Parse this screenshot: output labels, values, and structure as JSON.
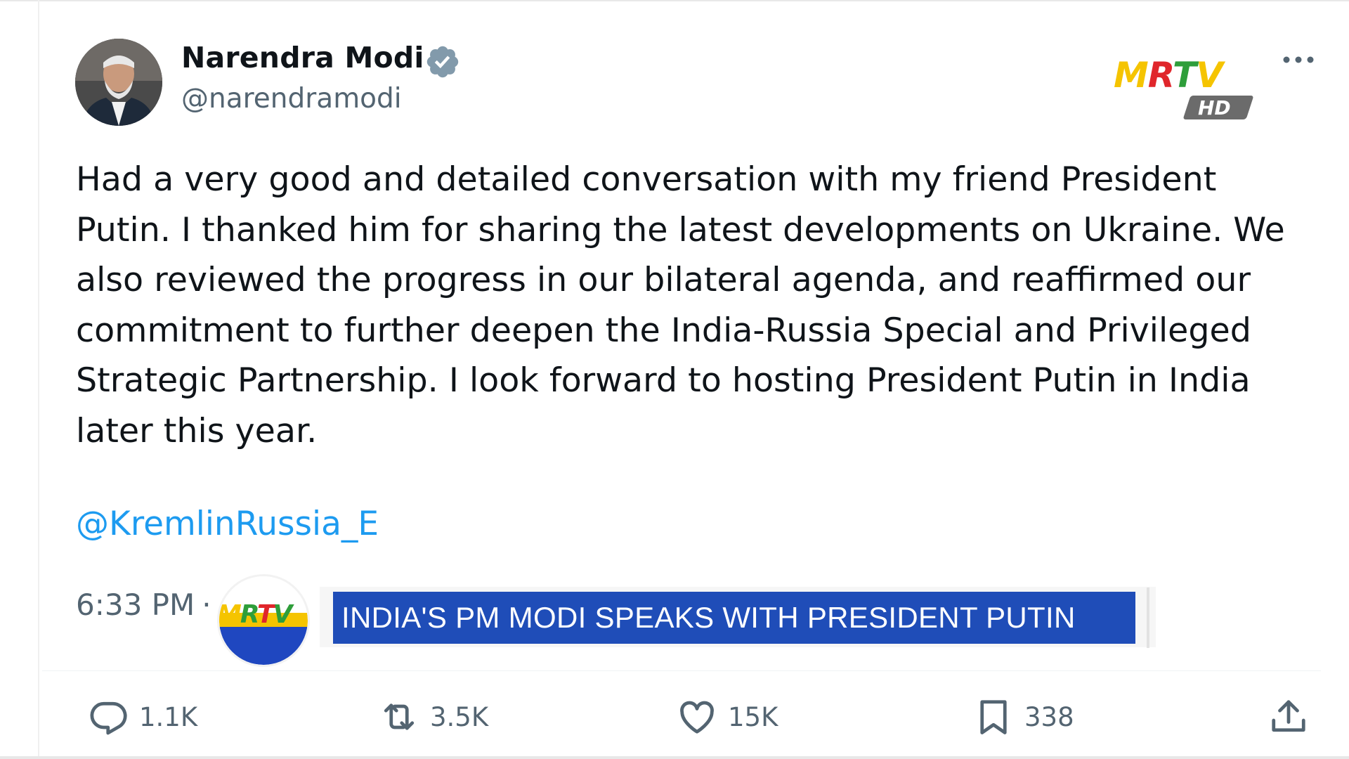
{
  "author": {
    "name": "Narendra Modi",
    "handle": "@narendramodi",
    "verified": true
  },
  "tweet": {
    "text": "Had a very good and detailed conversation with my friend President Putin. I thanked him for sharing the latest developments on Ukraine. We also reviewed the progress in our bilateral agenda, and reaffirmed our commitment to further deepen the India-Russia Special and Privileged Strategic Partnership. I look forward to hosting President Putin in India later this year.",
    "mention": "@KremlinRussia_E",
    "time": "6:33 PM",
    "time_separator": "·"
  },
  "actions": {
    "reply_count": "1.1K",
    "retweet_count": "3.5K",
    "like_count": "15K",
    "bookmark_count": "338"
  },
  "broadcast": {
    "channel_logo": "MRTV",
    "channel_logo_sub": "HD",
    "ticker_logo": "MRTV",
    "ticker_text": "INDIA'S PM MODI SPEAKS WITH PRESIDENT PUTIN"
  },
  "icons": {
    "verified": "verified-badge-icon",
    "more": "more-options-icon",
    "reply": "reply-bubble-icon",
    "retweet": "retweet-icon",
    "like": "heart-icon",
    "bookmark": "bookmark-icon",
    "share": "share-icon"
  },
  "colors": {
    "verified_badge": "#829aab",
    "mention": "#1d9bf0",
    "secondary_text": "#536471",
    "ticker_bar": "#1f4db8",
    "logo_yellow": "#f5c400",
    "logo_green": "#2e9e3a",
    "logo_red": "#e0262b",
    "logo_blue": "#1f47c0"
  }
}
